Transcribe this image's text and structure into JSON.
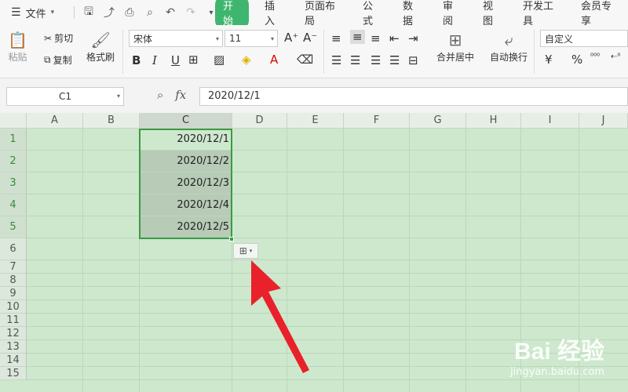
{
  "menubar": {
    "file_label": "文件",
    "tabs": [
      {
        "label": "开始",
        "active": true
      },
      {
        "label": "插入"
      },
      {
        "label": "页面布局"
      },
      {
        "label": "公式"
      },
      {
        "label": "数据"
      },
      {
        "label": "审阅"
      },
      {
        "label": "视图"
      },
      {
        "label": "开发工具"
      },
      {
        "label": "会员专享"
      }
    ]
  },
  "ribbon": {
    "paste": "粘贴",
    "cut": "剪切",
    "copy": "复制",
    "format_painter": "格式刷",
    "font_name": "宋体",
    "font_size": "11",
    "merge_center": "合并居中",
    "auto_wrap": "自动换行",
    "number_format": "自定义",
    "currency": "¥",
    "percent": "%"
  },
  "formula_bar": {
    "name_box": "C1",
    "formula": "2020/12/1"
  },
  "sheet": {
    "columns": [
      "A",
      "B",
      "C",
      "D",
      "E",
      "F",
      "G",
      "H",
      "I",
      "J"
    ],
    "rows": [
      "1",
      "2",
      "3",
      "4",
      "5",
      "6",
      "7",
      "8",
      "9",
      "10",
      "11",
      "12",
      "13",
      "14",
      "15"
    ],
    "cells_c": [
      "2020/12/1",
      "2020/12/2",
      "2020/12/3",
      "2020/12/4",
      "2020/12/5"
    ]
  },
  "watermark": {
    "logo": "Bai  经验",
    "url": "jingyan.baidu.com"
  },
  "colors": {
    "accent": "#3fb66f",
    "sheet_bg": "#cde8cd",
    "selection_border": "#3b9a44"
  }
}
